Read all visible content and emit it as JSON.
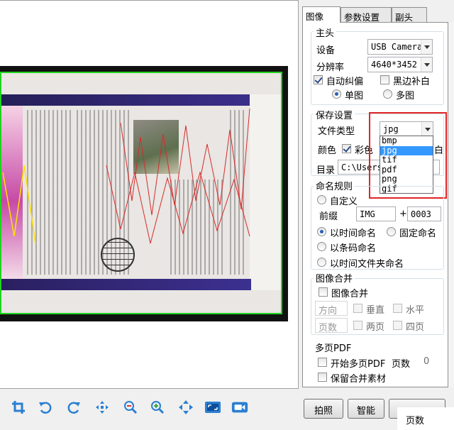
{
  "tabs": [
    "图像",
    "参数设置",
    "副头"
  ],
  "main_camera": {
    "group_label": "主头",
    "device_label": "设备",
    "device_value": "USB Camera",
    "resolution_label": "分辨率",
    "resolution_value": "4640*3452",
    "auto_deskew_label": "自动纠偏",
    "black_fill_label": "黑边补白",
    "single_label": "单图",
    "multi_label": "多图"
  },
  "save_settings": {
    "group_label": "保存设置",
    "filetype_label": "文件类型",
    "filetype_value": "jpg",
    "filetype_options": [
      "bmp",
      "jpg",
      "tif",
      "pdf",
      "png",
      "gif"
    ],
    "color_label": "颜色",
    "color_option": "彩色",
    "color_option_right": "白",
    "dir_label": "目录",
    "dir_value": "C:\\Users"
  },
  "naming": {
    "group_label": "命名规则",
    "custom_label": "自定义",
    "prefix_label": "前缀",
    "prefix_value": "IMG",
    "plus": "+",
    "counter_value": "0003",
    "by_time_label": "以时间命名",
    "fixed_label": "固定命名",
    "by_barcode_label": "以条码命名",
    "by_time_folder_label": "以时间文件夹命名"
  },
  "merge": {
    "group_label": "图像合并",
    "merge_label": "图像合并",
    "direction_label": "方向",
    "vertical_label": "垂直",
    "horizontal_label": "水平",
    "pages_label": "页数",
    "two_pages_label": "两页",
    "four_pages_label": "四页"
  },
  "pdf": {
    "group_label": "多页PDF",
    "start_label": "开始多页PDF",
    "pages_label": "页数",
    "pages_value": "0",
    "keep_label": "保留合并素材"
  },
  "buttons": {
    "capture": "拍照",
    "smart": "智能",
    "pages_popup": "页数"
  },
  "toolbar_icons": [
    "crop-icon",
    "rotate-left-icon",
    "rotate-right-icon",
    "fit-icon",
    "zoom-out-icon",
    "zoom-in-icon",
    "move-icon",
    "fullscreen-icon",
    "video-icon"
  ],
  "colors": {
    "accent": "#2b7fd1",
    "highlight": "#e02525",
    "selection": "#3399ff",
    "frame": "#1fd31f"
  }
}
